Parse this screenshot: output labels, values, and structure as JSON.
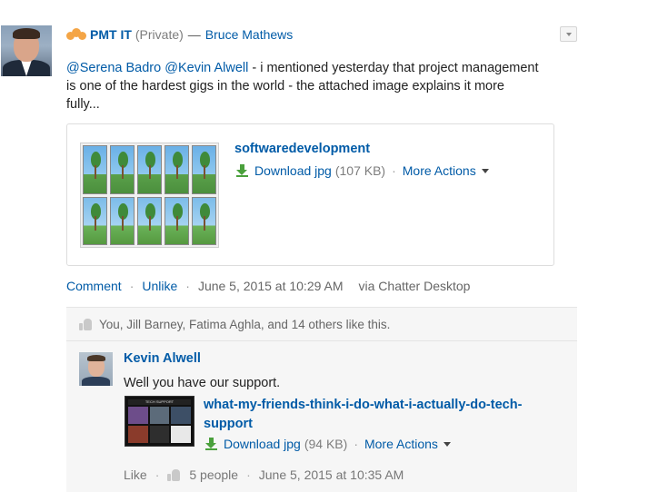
{
  "post": {
    "group_name": "PMT IT",
    "visibility": "(Private)",
    "separator": "—",
    "author": "Bruce Mathews",
    "mention1": "@Serena Badro",
    "mention2": "@Kevin Alwell",
    "body": " - i mentioned yesterday that project management is one of the hardest gigs in the world - the attached image explains it more fully...",
    "attachment": {
      "title": "softwaredevelopment",
      "download_label": "Download jpg",
      "size": "(107 KB)",
      "more_actions": "More Actions"
    },
    "actions": {
      "comment": "Comment",
      "unlike": "Unlike",
      "timestamp": "June 5, 2015 at 10:29 AM",
      "via": "via Chatter Desktop"
    }
  },
  "likes": {
    "text": "You, Jill Barney, Fatima Aghla, and 14 others like this."
  },
  "comment": {
    "author": "Kevin Alwell",
    "text": "Well you have our support.",
    "attachment": {
      "title": "what-my-friends-think-i-do-what-i-actually-do-tech-support",
      "download_label": "Download jpg",
      "size": "(94 KB)",
      "more_actions": "More Actions",
      "thumb_header": "TECH SUPPORT"
    },
    "like_label": "Like",
    "people_count": "5 people",
    "timestamp": "June 5, 2015 at 10:35 AM"
  },
  "icons": {
    "group": "group-icon",
    "download": "download-icon",
    "thumb": "thumbs-up-icon",
    "caret": "caret-down-icon"
  },
  "colors": {
    "link": "#015ba7",
    "download_green": "#4aa03c",
    "group_orange": "#f4a546",
    "panel_bg": "#f6f6f6"
  }
}
